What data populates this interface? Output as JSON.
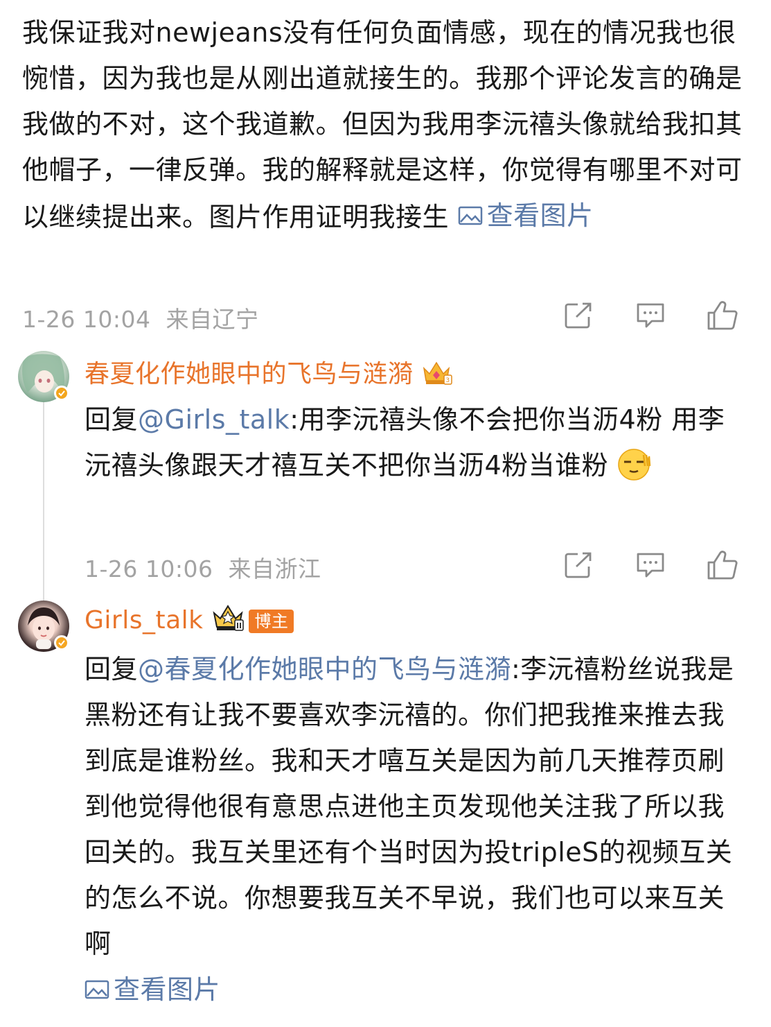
{
  "main_post": {
    "text": "我保证我对newjeans没有任何负面情感，现在的情况我也很惋惜，因为我也是从刚出道就接生的。我那个评论发言的确是我做的不对，这个我道歉。但因为我用李沅禧头像就给我扣其他帽子，一律反弹。我的解释就是这样，你觉得有哪里不对可以继续提出来。图片作用证明我接生 ",
    "view_image_label": "查看图片",
    "timestamp": "1-26 10:04",
    "location": "来自辽宁"
  },
  "reply1": {
    "username": "春夏化作她眼中的飞鸟与涟漪",
    "prefix": "回复",
    "mention": "@Girls_talk",
    "text": ":用李沅禧头像不会把你当沥4粉 用李沅禧头像跟天才禧互关不把你当沥4粉当谁粉",
    "emoji": "doge-emoji",
    "timestamp": "1-26 10:06",
    "location": "来自浙江"
  },
  "reply2": {
    "username": "Girls_talk",
    "host_tag": "博主",
    "prefix": "回复",
    "mention": "@春夏化作她眼中的飞鸟与涟漪",
    "text": ":李沅禧粉丝说我是黑粉还有让我不要喜欢李沅禧的。你们把我推来推去我到底是谁粉丝。我和天才嘻互关是因为前几天推荐页刷到他觉得他很有意思点进他主页发现他关注我了所以我回关的。我互关里还有个当时因为投tripleS的视频互关的怎么不说。你想要我互关不早说，我们也可以来互关啊",
    "view_image_label": "查看图片"
  },
  "icons": {
    "share": "share-icon",
    "comment": "comment-icon",
    "like": "like-icon",
    "image": "image-icon",
    "crown": "crown-badge-icon",
    "verified": "verified-badge-icon"
  },
  "colors": {
    "username": "#e8742b",
    "link": "#5b7aa8",
    "meta": "#a3a3a3",
    "host_tag_bg": "#f07a25"
  }
}
